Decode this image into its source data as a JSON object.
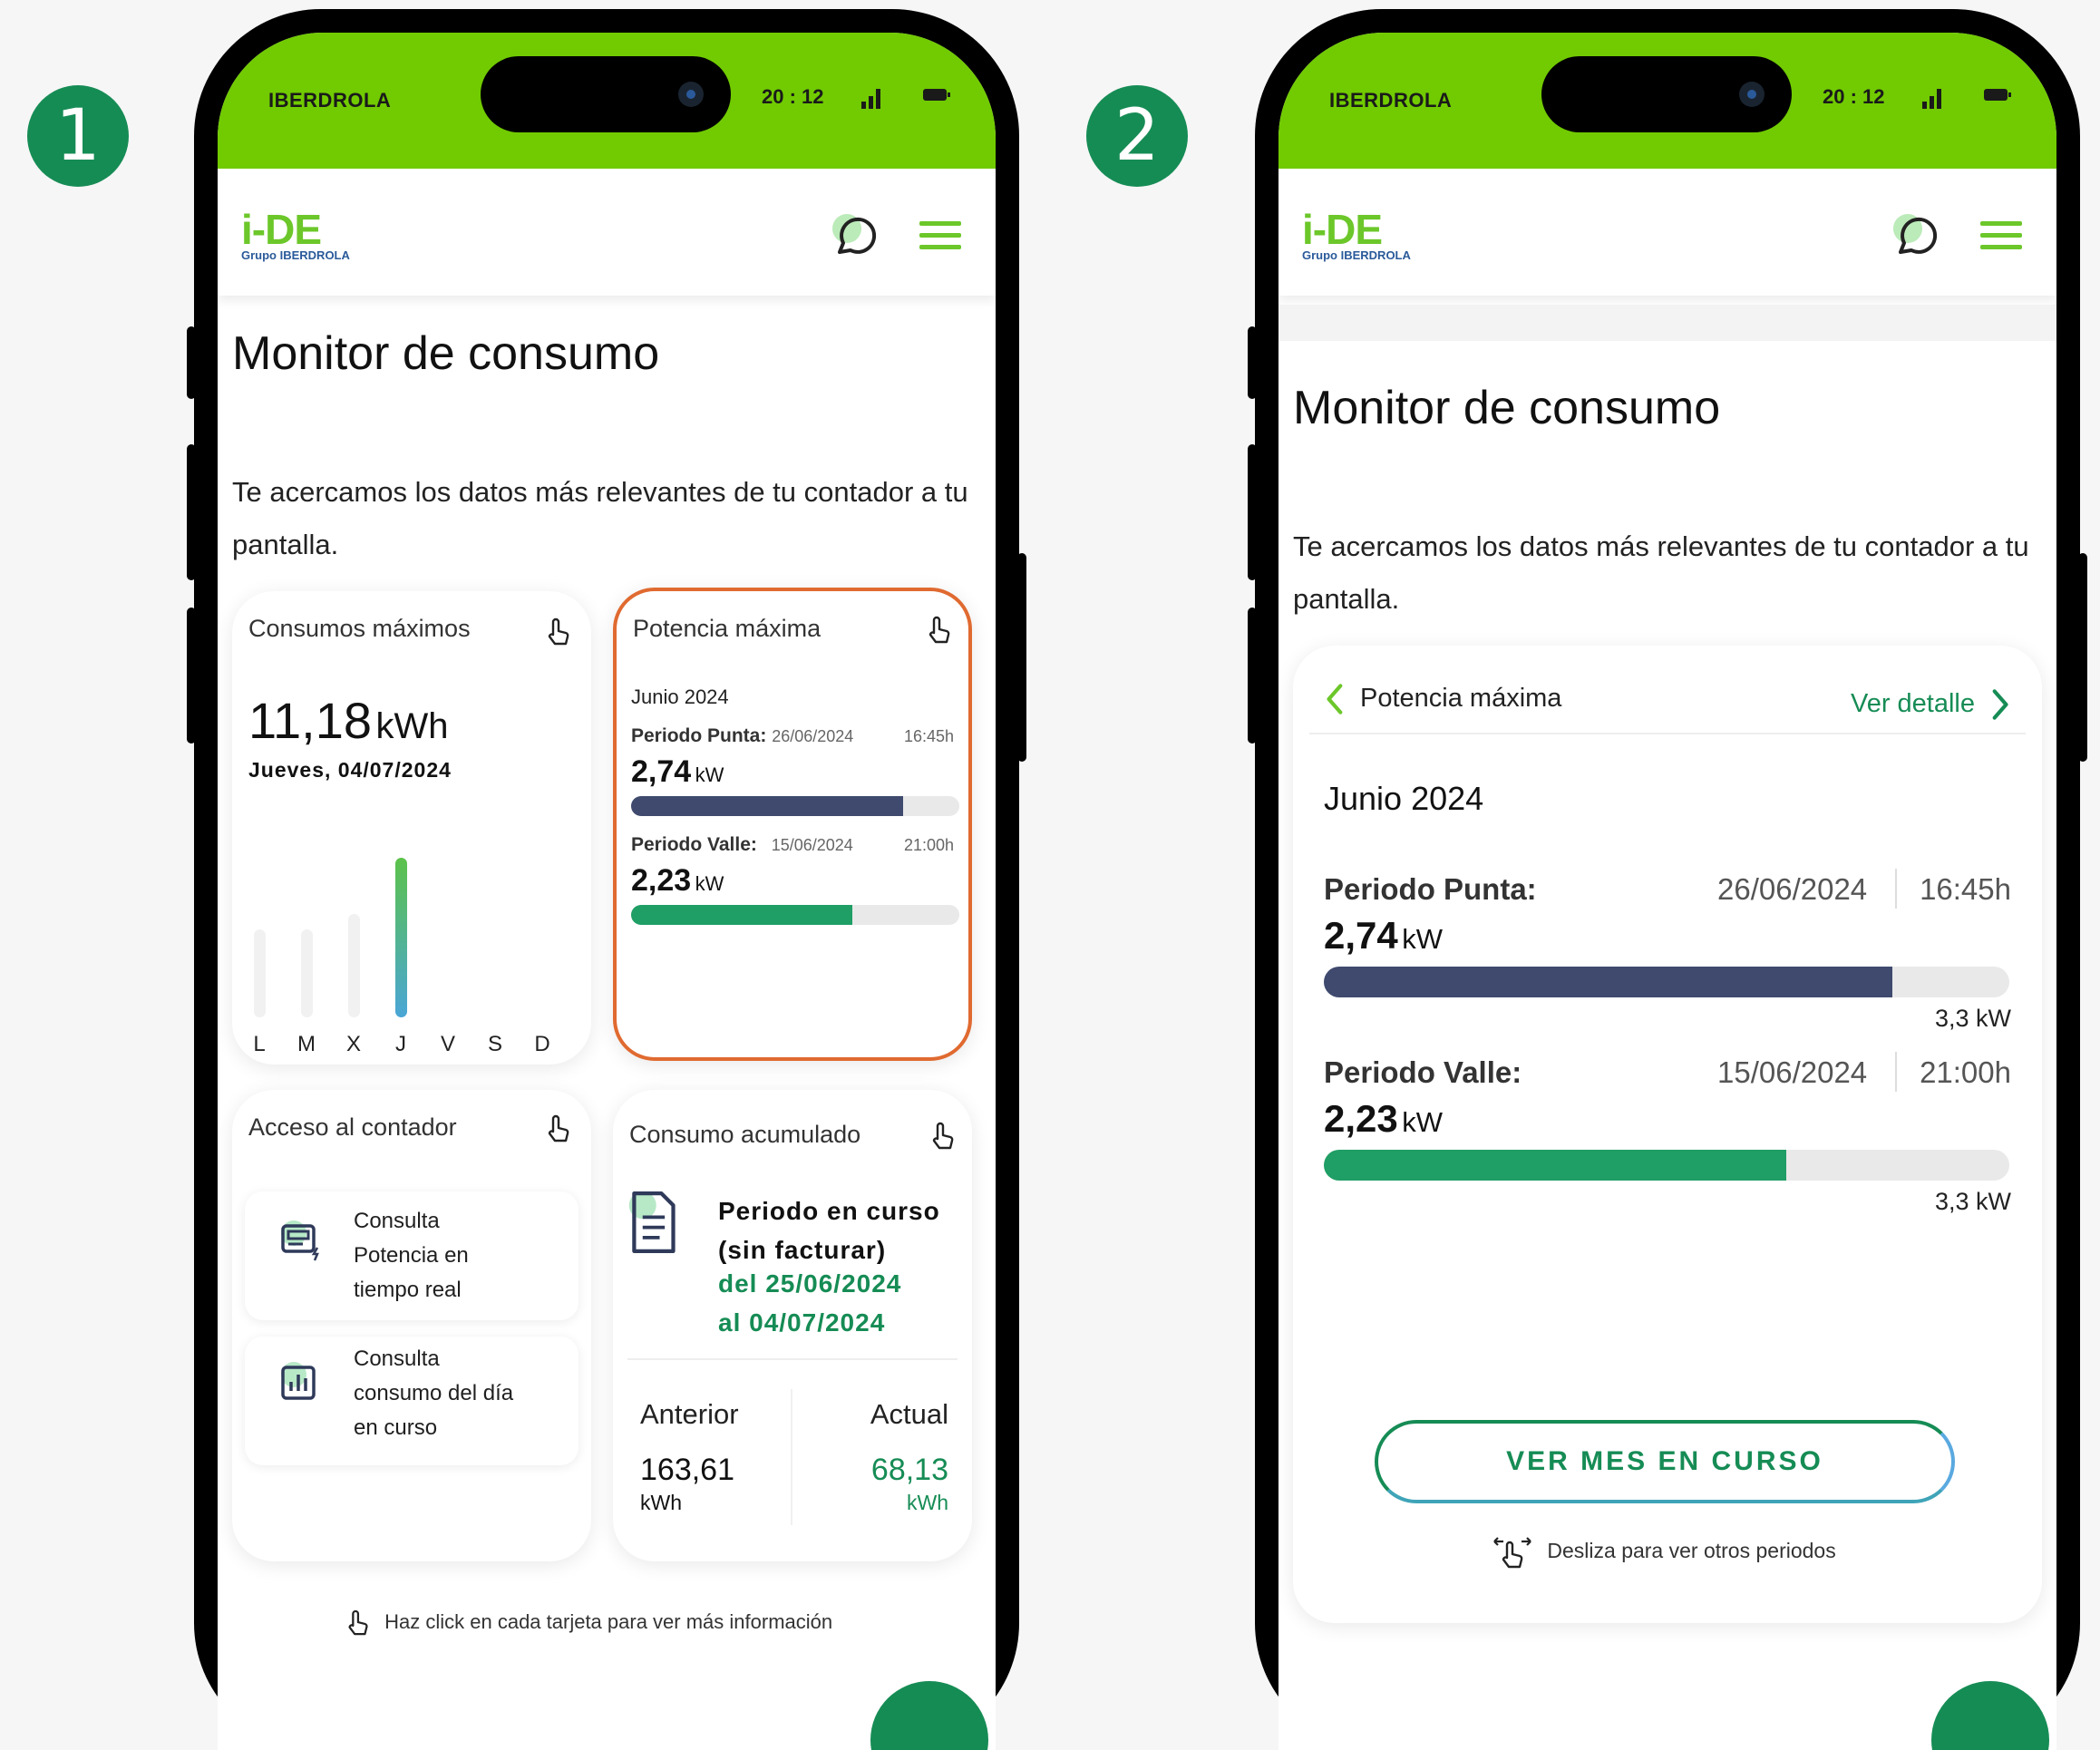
{
  "steps": [
    "1",
    "2"
  ],
  "status": {
    "carrier": "IBERDROLA",
    "time": "20 : 12"
  },
  "brand": {
    "logo": "i-DE",
    "logo_sub": "Grupo IBERDROLA",
    "primary": "#71cb00",
    "accent": "#168c55",
    "navy": "#3f4a6e"
  },
  "icons": [
    "chat-bubble-icon",
    "hamburger-menu-icon",
    "tap-hand-icon",
    "meter-icon",
    "bar-chart-icon",
    "document-icon",
    "chevron-left-icon",
    "chevron-right-icon",
    "swipe-hand-icon"
  ],
  "screen1": {
    "title": "Monitor de consumo",
    "intro": "Te acercamos los datos más relevantes de tu contador a tu pantalla.",
    "card_max": {
      "title": "Consumos máximos",
      "value": "11,18",
      "unit": "kWh",
      "date": "Jueves, 04/07/2024",
      "days": [
        "L",
        "M",
        "X",
        "J",
        "V",
        "S",
        "D"
      ],
      "bar_levels": [
        0.55,
        0.55,
        0.65,
        1,
        0,
        0,
        0
      ],
      "active_day": 3
    },
    "card_power": {
      "title": "Potencia máxima",
      "month": "Junio 2024",
      "punta_label": "Periodo Punta:",
      "punta_date": "26/06/2024",
      "punta_time": "16:45h",
      "punta_value": "2,74",
      "punta_unit": "kW",
      "punta_fraction": 0.83,
      "valle_label": "Periodo Valle:",
      "valle_date": "15/06/2024",
      "valle_time": "21:00h",
      "valle_value": "2,23",
      "valle_unit": "kW",
      "valle_fraction": 0.675
    },
    "card_meter": {
      "title": "Acceso al contador",
      "item1": "Consulta Potencia en tiempo real",
      "item2": "Consulta consumo del día en curso"
    },
    "card_cum": {
      "title": "Consumo acumulado",
      "period_title": "Periodo en curso (sin facturar)",
      "period_from": "del 25/06/2024",
      "period_to": "al 04/07/2024",
      "prev_label": "Anterior",
      "prev_value": "163,61",
      "prev_unit": "kWh",
      "curr_label": "Actual",
      "curr_value": "68,13",
      "curr_unit": "kWh"
    },
    "hint": "Haz click en cada tarjeta para ver más información"
  },
  "screen2": {
    "title": "Monitor de consumo",
    "intro": "Te acercamos los datos más relevantes de tu contador a tu pantalla.",
    "card_title": "Potencia máxima",
    "detail_link": "Ver detalle",
    "month": "Junio 2024",
    "punta_label": "Periodo Punta:",
    "punta_date": "26/06/2024",
    "punta_time": "16:45h",
    "punta_value": "2,74",
    "punta_unit": "kW",
    "punta_fraction": 0.83,
    "punta_max": "3,3 kW",
    "valle_label": "Periodo Valle:",
    "valle_date": "15/06/2024",
    "valle_time": "21:00h",
    "valle_value": "2,23",
    "valle_unit": "kW",
    "valle_fraction": 0.675,
    "valle_max": "3,3 kW",
    "cta": "VER MES EN CURSO",
    "swipe_hint": "Desliza para ver otros periodos"
  }
}
